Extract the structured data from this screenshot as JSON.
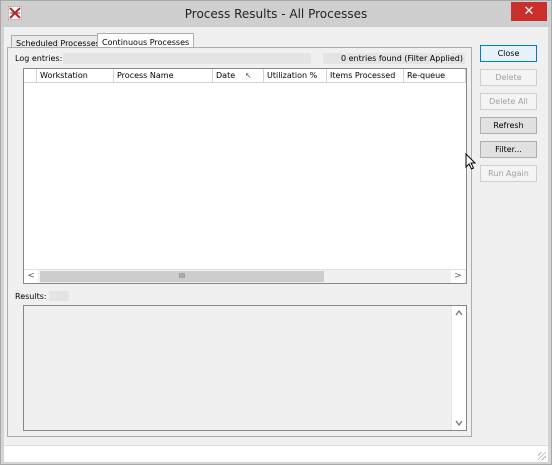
{
  "window": {
    "title": "Process Results - All Processes",
    "close_glyph": "✕"
  },
  "tabs": [
    {
      "label": "Scheduled Processes",
      "active": false
    },
    {
      "label": "Continuous Processes",
      "active": true
    }
  ],
  "log": {
    "label": "Log entries:",
    "count_text": "0 entries found (Filter Applied)",
    "columns": [
      "Workstation",
      "Process Name",
      "Date",
      "Utilization %",
      "Items Processed",
      "Re-queue"
    ],
    "sort_glyph": "↖",
    "rows": []
  },
  "scroll": {
    "left_glyph": "<",
    "right_glyph": ">",
    "up_glyph": "^",
    "down_glyph": "v",
    "thumb_glyph": "III"
  },
  "results": {
    "label": "Results:"
  },
  "buttons": {
    "close": "Close",
    "delete": "Delete",
    "delete_all": "Delete All",
    "refresh": "Refresh",
    "filter": "Filter...",
    "run_again": "Run Again"
  },
  "colors": {
    "close_button": "#c9302c",
    "default_button_border": "#0078d7"
  },
  "icons": {
    "app": "process-app-icon",
    "cursor": "mouse-pointer-icon"
  }
}
